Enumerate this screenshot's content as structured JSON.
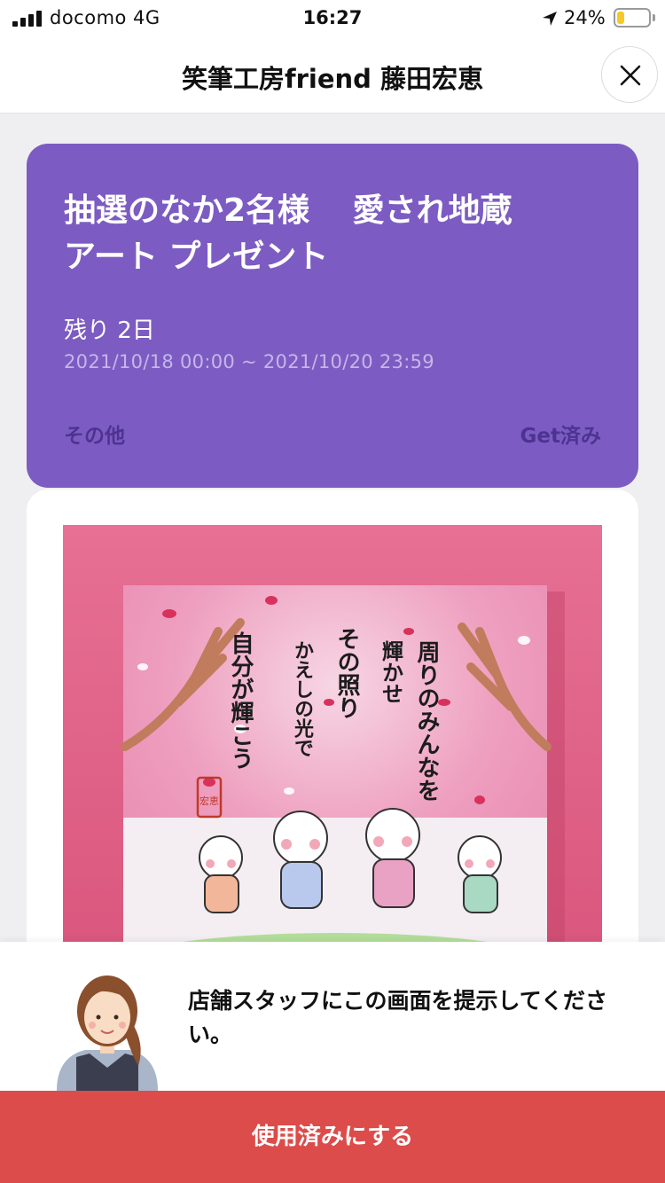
{
  "status_bar": {
    "carrier": "docomo  4G",
    "time": "16:27",
    "battery": "24%",
    "battery_level": 0.24,
    "icons": [
      "signal-bars-icon",
      "location-arrow-icon",
      "battery-icon"
    ]
  },
  "header": {
    "title": "笑筆工房friend 藤田宏恵",
    "close_icon": "close-icon"
  },
  "coupon": {
    "title": "抽選のなか2名様　 愛され地蔵\nアート プレゼント",
    "remaining": "残り  2日",
    "period": "2021/10/18 00:00 ~ 2021/10/20 23:59",
    "category": "その他",
    "status": "Get済み",
    "color": "#7c5cc2"
  },
  "artwork": {
    "calligraphy": [
      "周りのみんなを",
      "輝かせ",
      "その照り",
      "かえしの光で",
      "自分が輝こう"
    ],
    "seal": "宏恵"
  },
  "bottom": {
    "notice": "店舗スタッフにこの画面を提示してください。",
    "button_label": "使用済みにする",
    "button_color": "#dc4c4a"
  }
}
